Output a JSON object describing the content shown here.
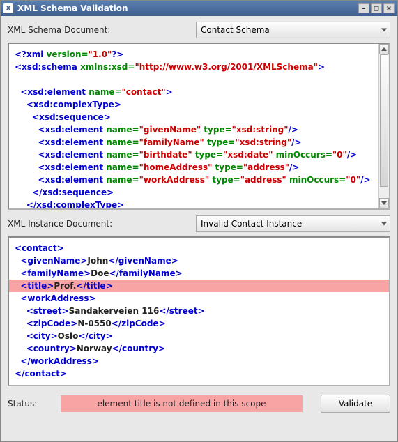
{
  "window": {
    "title": "XML Schema Validation"
  },
  "schema_section": {
    "label": "XML Schema Document:",
    "combo_value": "Contact Schema",
    "code_html": "<span class='t-bracket'>&lt;?</span><span class='t-tag'>xml</span> <span class='t-xmlk'>version=</span><span class='t-attrval'>\"1.0\"</span><span class='t-bracket'>?&gt;</span>\n<span class='t-bracket'>&lt;</span><span class='t-tag'>xsd:schema</span> <span class='t-attrname'>xmlns:xsd=</span><span class='t-attrval'>\"http://www.w3.org/2001/XMLSchema\"</span><span class='t-bracket'>&gt;</span>\n\n  <span class='t-bracket'>&lt;</span><span class='t-tag'>xsd:element</span> <span class='t-attrname'>name=</span><span class='t-attrval'>\"contact\"</span><span class='t-bracket'>&gt;</span>\n    <span class='t-bracket'>&lt;</span><span class='t-tag'>xsd:complexType</span><span class='t-bracket'>&gt;</span>\n      <span class='t-bracket'>&lt;</span><span class='t-tag'>xsd:sequence</span><span class='t-bracket'>&gt;</span>\n        <span class='t-bracket'>&lt;</span><span class='t-tag'>xsd:element</span> <span class='t-attrname'>name=</span><span class='t-attrval'>\"givenName\"</span> <span class='t-attrname'>type=</span><span class='t-attrval'>\"xsd:string\"</span><span class='t-bracket'>/&gt;</span>\n        <span class='t-bracket'>&lt;</span><span class='t-tag'>xsd:element</span> <span class='t-attrname'>name=</span><span class='t-attrval'>\"familyName\"</span> <span class='t-attrname'>type=</span><span class='t-attrval'>\"xsd:string\"</span><span class='t-bracket'>/&gt;</span>\n        <span class='t-bracket'>&lt;</span><span class='t-tag'>xsd:element</span> <span class='t-attrname'>name=</span><span class='t-attrval'>\"birthdate\"</span> <span class='t-attrname'>type=</span><span class='t-attrval'>\"xsd:date\"</span> <span class='t-attrname'>minOccurs=</span><span class='t-attrval'>\"0\"</span><span class='t-bracket'>/&gt;</span>\n        <span class='t-bracket'>&lt;</span><span class='t-tag'>xsd:element</span> <span class='t-attrname'>name=</span><span class='t-attrval'>\"homeAddress\"</span> <span class='t-attrname'>type=</span><span class='t-attrval'>\"address\"</span><span class='t-bracket'>/&gt;</span>\n        <span class='t-bracket'>&lt;</span><span class='t-tag'>xsd:element</span> <span class='t-attrname'>name=</span><span class='t-attrval'>\"workAddress\"</span> <span class='t-attrname'>type=</span><span class='t-attrval'>\"address\"</span> <span class='t-attrname'>minOccurs=</span><span class='t-attrval'>\"0\"</span><span class='t-bracket'>/&gt;</span>\n      <span class='t-bracket'>&lt;/</span><span class='t-tag'>xsd:sequence</span><span class='t-bracket'>&gt;</span>\n    <span class='t-bracket'>&lt;/</span><span class='t-tag'>xsd:complexType</span><span class='t-bracket'>&gt;</span>\n  <span class='t-bracket'>&lt;/</span><span class='t-tag'>xsd:element</span><span class='t-bracket'>&gt;</span>"
  },
  "instance_section": {
    "label": "XML Instance Document:",
    "combo_value": "Invalid Contact Instance",
    "code_html": "<span class='t-bracket'>&lt;</span><span class='t-tag'>contact</span><span class='t-bracket'>&gt;</span>\n  <span class='t-bracket'>&lt;</span><span class='t-tag'>givenName</span><span class='t-bracket'>&gt;</span><span class='t-text'>John</span><span class='t-bracket'>&lt;/</span><span class='t-tag'>givenName</span><span class='t-bracket'>&gt;</span>\n  <span class='t-bracket'>&lt;</span><span class='t-tag'>familyName</span><span class='t-bracket'>&gt;</span><span class='t-text'>Doe</span><span class='t-bracket'>&lt;/</span><span class='t-tag'>familyName</span><span class='t-bracket'>&gt;</span>\n<span class='hl-line'>  <span class='t-bracket'>&lt;</span><span class='t-tag'>title</span><span class='t-bracket'>&gt;</span><span class='t-text'>Prof.</span><span class='t-bracket'>&lt;/</span><span class='t-tag'>title</span><span class='t-bracket'>&gt;</span></span>  <span class='t-bracket'>&lt;</span><span class='t-tag'>workAddress</span><span class='t-bracket'>&gt;</span>\n    <span class='t-bracket'>&lt;</span><span class='t-tag'>street</span><span class='t-bracket'>&gt;</span><span class='t-text'>Sandakerveien 116</span><span class='t-bracket'>&lt;/</span><span class='t-tag'>street</span><span class='t-bracket'>&gt;</span>\n    <span class='t-bracket'>&lt;</span><span class='t-tag'>zipCode</span><span class='t-bracket'>&gt;</span><span class='t-text'>N-0550</span><span class='t-bracket'>&lt;/</span><span class='t-tag'>zipCode</span><span class='t-bracket'>&gt;</span>\n    <span class='t-bracket'>&lt;</span><span class='t-tag'>city</span><span class='t-bracket'>&gt;</span><span class='t-text'>Oslo</span><span class='t-bracket'>&lt;/</span><span class='t-tag'>city</span><span class='t-bracket'>&gt;</span>\n    <span class='t-bracket'>&lt;</span><span class='t-tag'>country</span><span class='t-bracket'>&gt;</span><span class='t-text'>Norway</span><span class='t-bracket'>&lt;/</span><span class='t-tag'>country</span><span class='t-bracket'>&gt;</span>\n  <span class='t-bracket'>&lt;/</span><span class='t-tag'>workAddress</span><span class='t-bracket'>&gt;</span>\n<span class='t-bracket'>&lt;/</span><span class='t-tag'>contact</span><span class='t-bracket'>&gt;</span>"
  },
  "footer": {
    "status_label": "Status:",
    "status_message": "element title is not defined in this scope",
    "validate_label": "Validate"
  }
}
